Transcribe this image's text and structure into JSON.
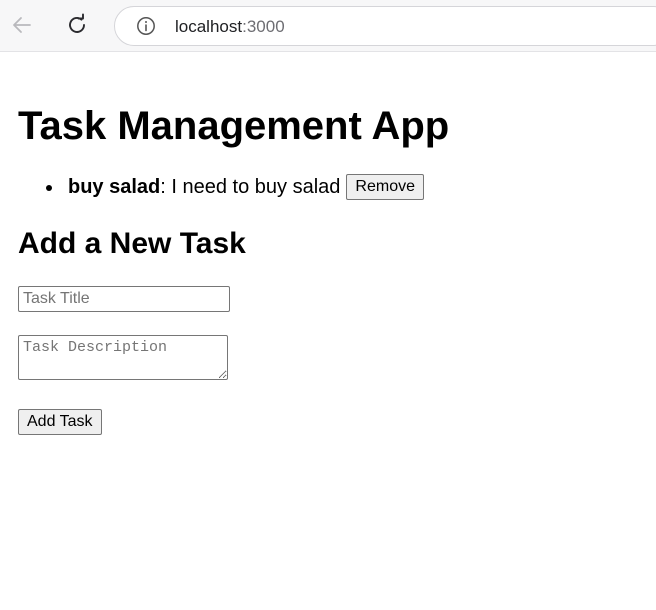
{
  "browser": {
    "url_host": "localhost",
    "url_port": ":3000",
    "back_icon": "back-arrow-icon",
    "reload_icon": "reload-icon",
    "info_icon": "info-icon"
  },
  "app": {
    "title": "Task Management App",
    "tasks": [
      {
        "title": "buy salad",
        "separator": ": ",
        "description": "I need to buy salad",
        "remove_label": "Remove"
      }
    ],
    "form": {
      "heading": "Add a New Task",
      "title_placeholder": "Task Title",
      "title_value": "",
      "description_placeholder": "Task Description",
      "description_value": "",
      "submit_label": "Add Task"
    }
  }
}
